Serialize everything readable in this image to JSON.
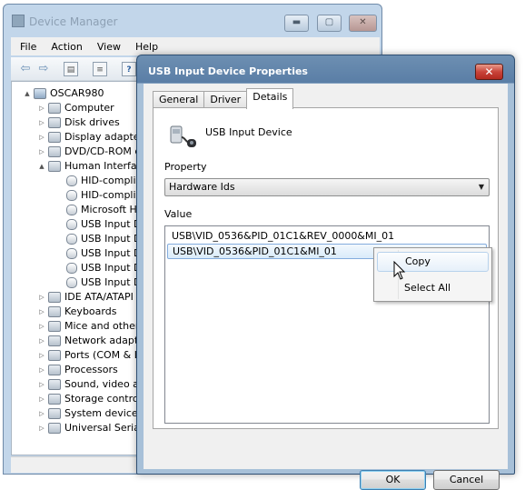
{
  "device_manager": {
    "title": "Device Manager",
    "menu": [
      "File",
      "Action",
      "View",
      "Help"
    ],
    "tree": [
      {
        "label": "OSCAR980",
        "level": 0,
        "expander": "▲",
        "icon": "computer-root-icon"
      },
      {
        "label": "Computer",
        "level": 1,
        "expander": "▷",
        "icon": "computer-icon"
      },
      {
        "label": "Disk drives",
        "level": 1,
        "expander": "▷",
        "icon": "disk-icon"
      },
      {
        "label": "Display adapter",
        "level": 1,
        "expander": "▷",
        "icon": "display-icon"
      },
      {
        "label": "DVD/CD-ROM d",
        "level": 1,
        "expander": "▷",
        "icon": "dvd-icon"
      },
      {
        "label": "Human Interfac",
        "level": 1,
        "expander": "▲",
        "icon": "hid-icon"
      },
      {
        "label": "HID-complia",
        "level": 2,
        "expander": "",
        "icon": "hid-device-icon"
      },
      {
        "label": "HID-complia",
        "level": 2,
        "expander": "",
        "icon": "hid-device-icon"
      },
      {
        "label": "Microsoft H",
        "level": 2,
        "expander": "",
        "icon": "hid-device-icon"
      },
      {
        "label": "USB Input D",
        "level": 2,
        "expander": "",
        "icon": "hid-device-icon"
      },
      {
        "label": "USB Input D",
        "level": 2,
        "expander": "",
        "icon": "hid-device-icon"
      },
      {
        "label": "USB Input D",
        "level": 2,
        "expander": "",
        "icon": "hid-device-icon"
      },
      {
        "label": "USB Input D",
        "level": 2,
        "expander": "",
        "icon": "hid-device-icon"
      },
      {
        "label": "USB Input D",
        "level": 2,
        "expander": "",
        "icon": "hid-device-icon"
      },
      {
        "label": "IDE ATA/ATAPI",
        "level": 1,
        "expander": "▷",
        "icon": "ide-icon"
      },
      {
        "label": "Keyboards",
        "level": 1,
        "expander": "▷",
        "icon": "keyboard-icon"
      },
      {
        "label": "Mice and other",
        "level": 1,
        "expander": "▷",
        "icon": "mouse-icon"
      },
      {
        "label": "Network adapte",
        "level": 1,
        "expander": "▷",
        "icon": "network-icon"
      },
      {
        "label": "Ports (COM & L",
        "level": 1,
        "expander": "▷",
        "icon": "port-icon"
      },
      {
        "label": "Processors",
        "level": 1,
        "expander": "▷",
        "icon": "processor-icon"
      },
      {
        "label": "Sound, video ar",
        "level": 1,
        "expander": "▷",
        "icon": "sound-icon"
      },
      {
        "label": "Storage control",
        "level": 1,
        "expander": "▷",
        "icon": "storage-icon"
      },
      {
        "label": "System devices",
        "level": 1,
        "expander": "▷",
        "icon": "system-icon"
      },
      {
        "label": "Universal Serial",
        "level": 1,
        "expander": "▷",
        "icon": "usb-icon"
      }
    ]
  },
  "dialog": {
    "title": "USB Input Device Properties",
    "close_glyph": "✕",
    "tabs": [
      "General",
      "Driver",
      "Details"
    ],
    "active_tab": "Details",
    "device_name": "USB Input Device",
    "property_label": "Property",
    "property_value": "Hardware Ids",
    "value_label": "Value",
    "values": [
      "USB\\VID_0536&PID_01C1&REV_0000&MI_01",
      "USB\\VID_0536&PID_01C1&MI_01"
    ],
    "selected_value_index": 1,
    "ok_label": "OK",
    "cancel_label": "Cancel"
  },
  "context_menu": {
    "items": [
      "Copy",
      "Select All"
    ],
    "highlighted": "Copy"
  },
  "colors": {
    "title_bar": "#5a7ea6",
    "close_red": "#c9443a",
    "selection": "#d9ebfa"
  }
}
